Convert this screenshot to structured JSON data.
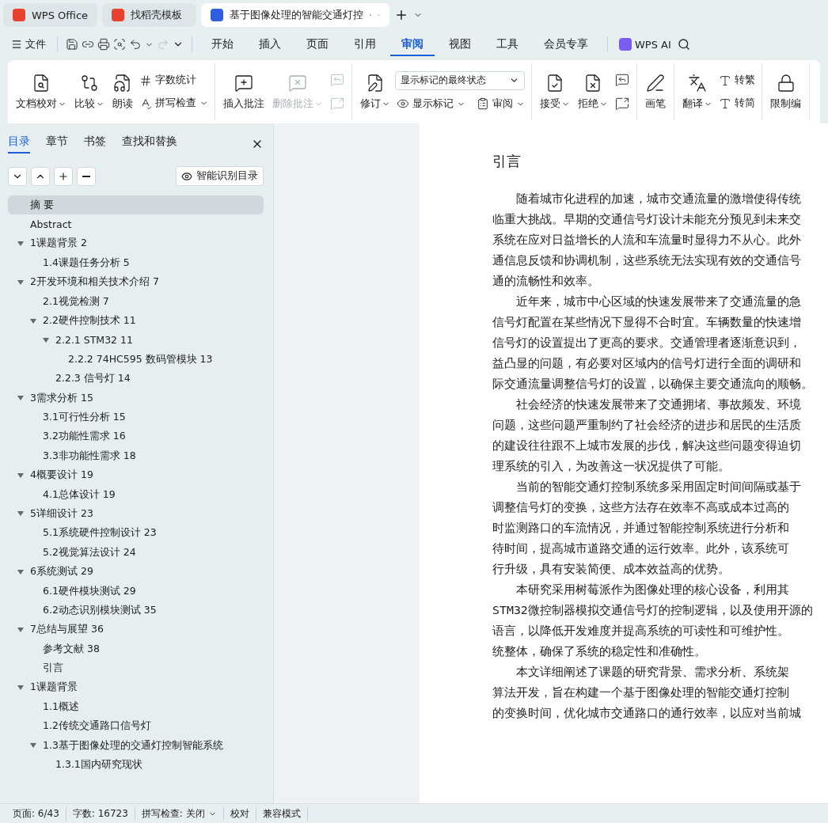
{
  "tabs": [
    {
      "kind": "home",
      "label": "WPS Office",
      "selected": false
    },
    {
      "kind": "template",
      "label": "找稻壳模板",
      "selected": false
    },
    {
      "kind": "doc",
      "label": "基于图像处理的智能交通灯控",
      "selected": true
    }
  ],
  "menu": {
    "file": "文件",
    "tabs": [
      {
        "label": "开始",
        "selected": false
      },
      {
        "label": "插入",
        "selected": false
      },
      {
        "label": "页面",
        "selected": false
      },
      {
        "label": "引用",
        "selected": false
      },
      {
        "label": "审阅",
        "selected": true
      },
      {
        "label": "视图",
        "selected": false
      },
      {
        "label": "工具",
        "selected": false
      },
      {
        "label": "会员专享",
        "selected": false
      }
    ],
    "ai": "WPS AI"
  },
  "ribbon": [
    {
      "columns": [
        [
          {
            "kind": "large",
            "label": "文档校对",
            "caret": true,
            "disabled": false
          }
        ],
        [
          {
            "kind": "large",
            "label": "比较",
            "caret": true,
            "disabled": false
          }
        ],
        [
          {
            "kind": "large",
            "label": "朗读",
            "caret": false,
            "disabled": false
          }
        ],
        [
          {
            "kind": "small",
            "label": "字数统计",
            "caret": false,
            "disabled": false
          },
          {
            "kind": "small",
            "label": "拼写检查",
            "caret": true,
            "disabled": false
          }
        ]
      ]
    },
    {
      "columns": [
        [
          {
            "kind": "large",
            "label": "插入批注",
            "caret": false,
            "disabled": false
          }
        ],
        [
          {
            "kind": "large",
            "label": "删除批注",
            "caret": true,
            "disabled": true
          }
        ],
        [
          {
            "kind": "icon",
            "disabled": true
          },
          {
            "kind": "icon",
            "disabled": true
          }
        ]
      ]
    },
    {
      "columns": [
        [
          {
            "kind": "large",
            "label": "修订",
            "caret": true,
            "disabled": false
          }
        ],
        [
          {
            "kind": "select",
            "value": "显示标记的最终状态"
          },
          {
            "kind": "pair",
            "items": [
              {
                "kind": "small",
                "label": "显示标记",
                "caret": true,
                "disabled": false
              },
              {
                "kind": "small",
                "label": "审阅",
                "caret": true,
                "disabled": false
              }
            ]
          }
        ]
      ]
    },
    {
      "columns": [
        [
          {
            "kind": "large",
            "label": "接受",
            "caret": true,
            "disabled": false
          }
        ],
        [
          {
            "kind": "large",
            "label": "拒绝",
            "caret": true,
            "disabled": false
          }
        ],
        [
          {
            "kind": "icon",
            "disabled": false
          },
          {
            "kind": "icon",
            "disabled": false
          }
        ]
      ]
    },
    {
      "columns": [
        [
          {
            "kind": "large",
            "label": "画笔",
            "caret": false,
            "disabled": false
          }
        ]
      ]
    },
    {
      "columns": [
        [
          {
            "kind": "large",
            "label": "翻译",
            "caret": true,
            "disabled": false
          }
        ],
        [
          {
            "kind": "small",
            "label": "转繁",
            "caret": false,
            "disabled": false
          },
          {
            "kind": "small",
            "label": "转简",
            "caret": false,
            "disabled": false
          }
        ]
      ]
    },
    {
      "columns": [
        [
          {
            "kind": "large",
            "label": "限制编",
            "caret": false,
            "disabled": false
          }
        ]
      ]
    }
  ],
  "sidebar": {
    "tabs": [
      {
        "label": "目录",
        "selected": true
      },
      {
        "label": "章节",
        "selected": false
      },
      {
        "label": "书签",
        "selected": false
      },
      {
        "label": "查找和替换",
        "selected": false
      }
    ],
    "smart_button": "智能识别目录",
    "toc": [
      {
        "label": "摘 要",
        "selected": true
      },
      {
        "label": "Abstract",
        "selected": false
      },
      {
        "label": "1课题背景  2",
        "selected": false,
        "expanded": true,
        "children": [
          {
            "label": "1.4课题任务分析  5",
            "selected": false
          }
        ]
      },
      {
        "label": "2开发环境和相关技术介绍  7",
        "selected": false,
        "expanded": true,
        "children": [
          {
            "label": "2.1视觉检测  7",
            "selected": false
          },
          {
            "label": "2.2硬件控制技术  11",
            "selected": false,
            "expanded": true,
            "children": [
              {
                "label": "2.2.1 STM32  11",
                "selected": false,
                "expanded": true,
                "children": [
                  {
                    "label": "2.2.2 74HC595 数码管模块  13",
                    "selected": false
                  }
                ]
              },
              {
                "label": "2.2.3 信号灯  14",
                "selected": false
              }
            ]
          }
        ]
      },
      {
        "label": "3需求分析  15",
        "selected": false,
        "expanded": true,
        "children": [
          {
            "label": "3.1可行性分析  15",
            "selected": false
          },
          {
            "label": "3.2功能性需求  16",
            "selected": false
          },
          {
            "label": "3.3非功能性需求  18",
            "selected": false
          }
        ]
      },
      {
        "label": "4概要设计  19",
        "selected": false,
        "expanded": true,
        "children": [
          {
            "label": "4.1总体设计  19",
            "selected": false
          }
        ]
      },
      {
        "label": "5详细设计  23",
        "selected": false,
        "expanded": true,
        "children": [
          {
            "label": "5.1系统硬件控制设计  23",
            "selected": false
          },
          {
            "label": "5.2视觉算法设计  24",
            "selected": false
          }
        ]
      },
      {
        "label": "6系统测试  29",
        "selected": false,
        "expanded": true,
        "children": [
          {
            "label": "6.1硬件模块测试  29",
            "selected": false
          },
          {
            "label": "6.2动态识别模块测试  35",
            "selected": false
          }
        ]
      },
      {
        "label": "7总结与展望  36",
        "selected": false,
        "expanded": true,
        "children": [
          {
            "label": "参考文献  38",
            "selected": false
          },
          {
            "label": "引言",
            "selected": false
          }
        ]
      },
      {
        "label": "1课题背景",
        "selected": false,
        "expanded": true,
        "children": [
          {
            "label": "1.1概述",
            "selected": false
          },
          {
            "label": "1.2传统交通路口信号灯",
            "selected": false
          },
          {
            "label": "1.3基于图像处理的交通灯控制智能系统",
            "selected": false,
            "expanded": true,
            "children": [
              {
                "label": "1.3.1国内研究现状",
                "selected": false
              }
            ]
          }
        ]
      }
    ]
  },
  "document": {
    "heading": "引言",
    "paragraphs": [
      [
        "随着城市化进程的加速，城市交通流量的激增使得传统",
        "临重大挑战。早期的交通信号灯设计未能充分预见到未来交",
        "系统在应对日益增长的人流和车流量时显得力不从心。此外",
        "通信息反馈和协调机制，这些系统无法实现有效的交通信号",
        "通的流畅性和效率。"
      ],
      [
        "近年来，城市中心区域的快速发展带来了交通流量的急",
        "信号灯配置在某些情况下显得不合时宜。车辆数量的快速增",
        "信号灯的设置提出了更高的要求。交通管理者逐渐意识到，",
        "益凸显的问题，有必要对区域内的信号灯进行全面的调研和",
        "际交通流量调整信号灯的设置，以确保主要交通流向的顺畅。"
      ],
      [
        "社会经济的快速发展带来了交通拥堵、事故频发、环境",
        "问题，这些问题严重制约了社会经济的进步和居民的生活质",
        "的建设往往跟不上城市发展的步伐，解决这些问题变得迫切",
        "理系统的引入，为改善这一状况提供了可能。"
      ],
      [
        "当前的智能交通灯控制系统多采用固定时间间隔或基于",
        "调整信号灯的变换，这些方法存在效率不高或成本过高的",
        "时监测路口的车流情况，并通过智能控制系统进行分析和",
        "待时间，提高城市道路交通的运行效率。此外，该系统可",
        "行升级，具有安装简便、成本效益高的优势。"
      ],
      [
        "本研究采用树莓派作为图像处理的核心设备，利用其",
        "STM32微控制器模拟交通信号灯的控制逻辑，以及使用开源的",
        "语言，以降低开发难度并提高系统的可读性和可维护性。",
        "统整体，确保了系统的稳定性和准确性。"
      ],
      [
        "本文详细阐述了课题的研究背景、需求分析、系统架",
        "算法开发，旨在构建一个基于图像处理的智能交通灯控制",
        "的变换时间，优化城市交通路口的通行效率，以应对当前城"
      ]
    ]
  },
  "status_bar": [
    {
      "kind": "text",
      "label": "页面: 6/43"
    },
    {
      "kind": "text",
      "label": "字数: 16723"
    },
    {
      "kind": "menu",
      "label": "拼写检查: 关闭"
    },
    {
      "kind": "text",
      "label": "校对"
    },
    {
      "kind": "text",
      "label": "兼容模式"
    }
  ]
}
